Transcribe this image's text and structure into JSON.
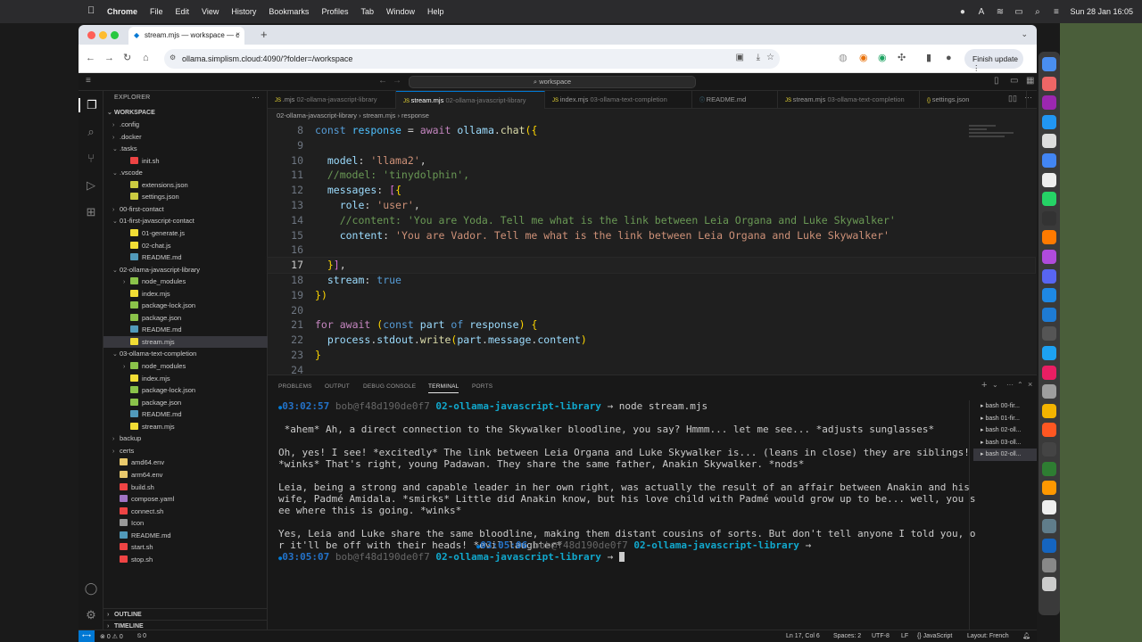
{
  "menubar": {
    "app": "Chrome",
    "items": [
      "File",
      "Edit",
      "View",
      "History",
      "Bookmarks",
      "Profiles",
      "Tab",
      "Window",
      "Help"
    ],
    "clock": "Sun 28 Jan  16:05"
  },
  "browser": {
    "tab_title": "stream.mjs — workspace — c",
    "url": "ollama.simplism.cloud:4090/?folder=/workspace",
    "finish_label": "Finish update"
  },
  "vscode": {
    "search": "workspace",
    "explorer_label": "EXPLORER",
    "workspace_label": "WORKSPACE",
    "tree": [
      {
        "label": ".config",
        "depth": 1,
        "type": "folder",
        "open": false
      },
      {
        "label": ".docker",
        "depth": 1,
        "type": "folder",
        "open": false
      },
      {
        "label": ".tasks",
        "depth": 1,
        "type": "folder",
        "open": true
      },
      {
        "label": "init.sh",
        "depth": 2,
        "type": "sh"
      },
      {
        "label": ".vscode",
        "depth": 1,
        "type": "folder",
        "open": true
      },
      {
        "label": "extensions.json",
        "depth": 2,
        "type": "json"
      },
      {
        "label": "settings.json",
        "depth": 2,
        "type": "json"
      },
      {
        "label": "00-first-contact",
        "depth": 1,
        "type": "folder",
        "open": false
      },
      {
        "label": "01-first-javascript-contact",
        "depth": 1,
        "type": "folder",
        "open": true
      },
      {
        "label": "01-generate.js",
        "depth": 2,
        "type": "js"
      },
      {
        "label": "02-chat.js",
        "depth": 2,
        "type": "js"
      },
      {
        "label": "README.md",
        "depth": 2,
        "type": "md"
      },
      {
        "label": "02-ollama-javascript-library",
        "depth": 1,
        "type": "folder",
        "open": true
      },
      {
        "label": "node_modules",
        "depth": 2,
        "type": "nm",
        "open": false
      },
      {
        "label": "index.mjs",
        "depth": 2,
        "type": "js"
      },
      {
        "label": "package-lock.json",
        "depth": 2,
        "type": "pkg"
      },
      {
        "label": "package.json",
        "depth": 2,
        "type": "pkg"
      },
      {
        "label": "README.md",
        "depth": 2,
        "type": "md"
      },
      {
        "label": "stream.mjs",
        "depth": 2,
        "type": "js",
        "selected": true
      },
      {
        "label": "03-ollama-text-completion",
        "depth": 1,
        "type": "folder",
        "open": true
      },
      {
        "label": "node_modules",
        "depth": 2,
        "type": "nm",
        "open": false
      },
      {
        "label": "index.mjs",
        "depth": 2,
        "type": "js"
      },
      {
        "label": "package-lock.json",
        "depth": 2,
        "type": "pkg"
      },
      {
        "label": "package.json",
        "depth": 2,
        "type": "pkg"
      },
      {
        "label": "README.md",
        "depth": 2,
        "type": "md"
      },
      {
        "label": "stream.mjs",
        "depth": 2,
        "type": "js"
      },
      {
        "label": "backup",
        "depth": 1,
        "type": "folder",
        "open": false
      },
      {
        "label": "certs",
        "depth": 1,
        "type": "folder",
        "open": false
      },
      {
        "label": "amd64.env",
        "depth": 1,
        "type": "env"
      },
      {
        "label": "arm64.env",
        "depth": 1,
        "type": "env"
      },
      {
        "label": "build.sh",
        "depth": 1,
        "type": "sh"
      },
      {
        "label": "compose.yaml",
        "depth": 1,
        "type": "yaml"
      },
      {
        "label": "connect.sh",
        "depth": 1,
        "type": "sh"
      },
      {
        "label": "Icon",
        "depth": 1,
        "type": "plain"
      },
      {
        "label": "README.md",
        "depth": 1,
        "type": "md"
      },
      {
        "label": "start.sh",
        "depth": 1,
        "type": "sh"
      },
      {
        "label": "stop.sh",
        "depth": 1,
        "type": "sh"
      }
    ],
    "outline_label": "OUTLINE",
    "timeline_label": "TIMELINE",
    "tabs": [
      {
        "name": ".mjs",
        "folder": "02-ollama-javascript-library",
        "active": false
      },
      {
        "name": "stream.mjs",
        "folder": "02-ollama-javascript-library",
        "active": true
      },
      {
        "name": "index.mjs",
        "folder": "03-ollama-text-completion",
        "active": false
      },
      {
        "name": "README.md",
        "folder": "",
        "active": false
      },
      {
        "name": "stream.mjs",
        "folder": "03-ollama-text-completion",
        "active": false
      },
      {
        "name": "settings.json",
        "folder": "",
        "active": false
      }
    ],
    "breadcrumb": [
      "02-ollama-javascript-library",
      "stream.mjs",
      "response"
    ],
    "code_lines": [
      {
        "n": "8",
        "text": "const response = await ollama.chat({"
      },
      {
        "n": "9",
        "text": ""
      },
      {
        "n": "10",
        "text": "  model: 'llama2',"
      },
      {
        "n": "11",
        "text": "  //model: 'tinydolphin',"
      },
      {
        "n": "12",
        "text": "  messages: [{"
      },
      {
        "n": "13",
        "text": "    role: 'user',"
      },
      {
        "n": "14",
        "text": "    //content: 'You are Yoda. Tell me what is the link between Leia Organa and Luke Skywalker'"
      },
      {
        "n": "15",
        "text": "    content: 'You are Vador. Tell me what is the link between Leia Organa and Luke Skywalker'"
      },
      {
        "n": "16",
        "text": ""
      },
      {
        "n": "17",
        "text": "  }],"
      },
      {
        "n": "18",
        "text": "  stream: true"
      },
      {
        "n": "19",
        "text": "})"
      },
      {
        "n": "20",
        "text": ""
      },
      {
        "n": "21",
        "text": "for await (const part of response) {"
      },
      {
        "n": "22",
        "text": "  process.stdout.write(part.message.content)"
      },
      {
        "n": "23",
        "text": "}"
      },
      {
        "n": "24",
        "text": ""
      }
    ],
    "panel_tabs": [
      "PROBLEMS",
      "OUTPUT",
      "DEBUG CONSOLE",
      "TERMINAL",
      "PORTS"
    ],
    "terminal": {
      "prompt_time_1": "03:02:57",
      "prompt_time_2": "03:05:06",
      "prompt_time_3": "03:05:07",
      "host": "bob@f48d190de0f7",
      "dir": "02-ollama-javascript-library",
      "command": "node stream.mjs",
      "output": [
        " *ahem* Ah, a direct connection to the Skywalker bloodline, you say? Hmmm... let me see... *adjusts sunglasses*",
        "",
        "Oh, yes! I see! *excitedly* The link between Leia Organa and Luke Skywalker is... (leans in close) they are siblings!",
        "*winks* That's right, young Padawan. They share the same father, Anakin Skywalker. *nods*",
        "",
        "Leia, being a strong and capable leader in her own right, was actually the result of an affair between Anakin and his",
        "wife, Padmé Amidala. *smirks* Little did Anakin know, but his love child with Padmé would grow up to be... well, you s",
        "ee where this is going. *winks*",
        "",
        "Yes, Leia and Luke share the same bloodline, making them distant cousins of sorts. But don't tell anyone I told you, o",
        "r it'll be off with their heads! *evil laughter*"
      ],
      "sessions": [
        "bash 00-fir...",
        "bash 01-fir...",
        "bash 02-oll...",
        "bash 03-oll...",
        "bash 02-oll..."
      ]
    },
    "status": {
      "errors": "0",
      "warnings": "0",
      "ports": "0",
      "position": "Ln 17, Col 6",
      "spaces": "Spaces: 2",
      "encoding": "UTF-8",
      "eol": "LF",
      "language": "JavaScript",
      "layout": "Layout: French"
    }
  },
  "colors": {
    "accent": "#0078d4",
    "keyword": "#569cd6",
    "string": "#ce9178",
    "comment": "#6a9955"
  }
}
